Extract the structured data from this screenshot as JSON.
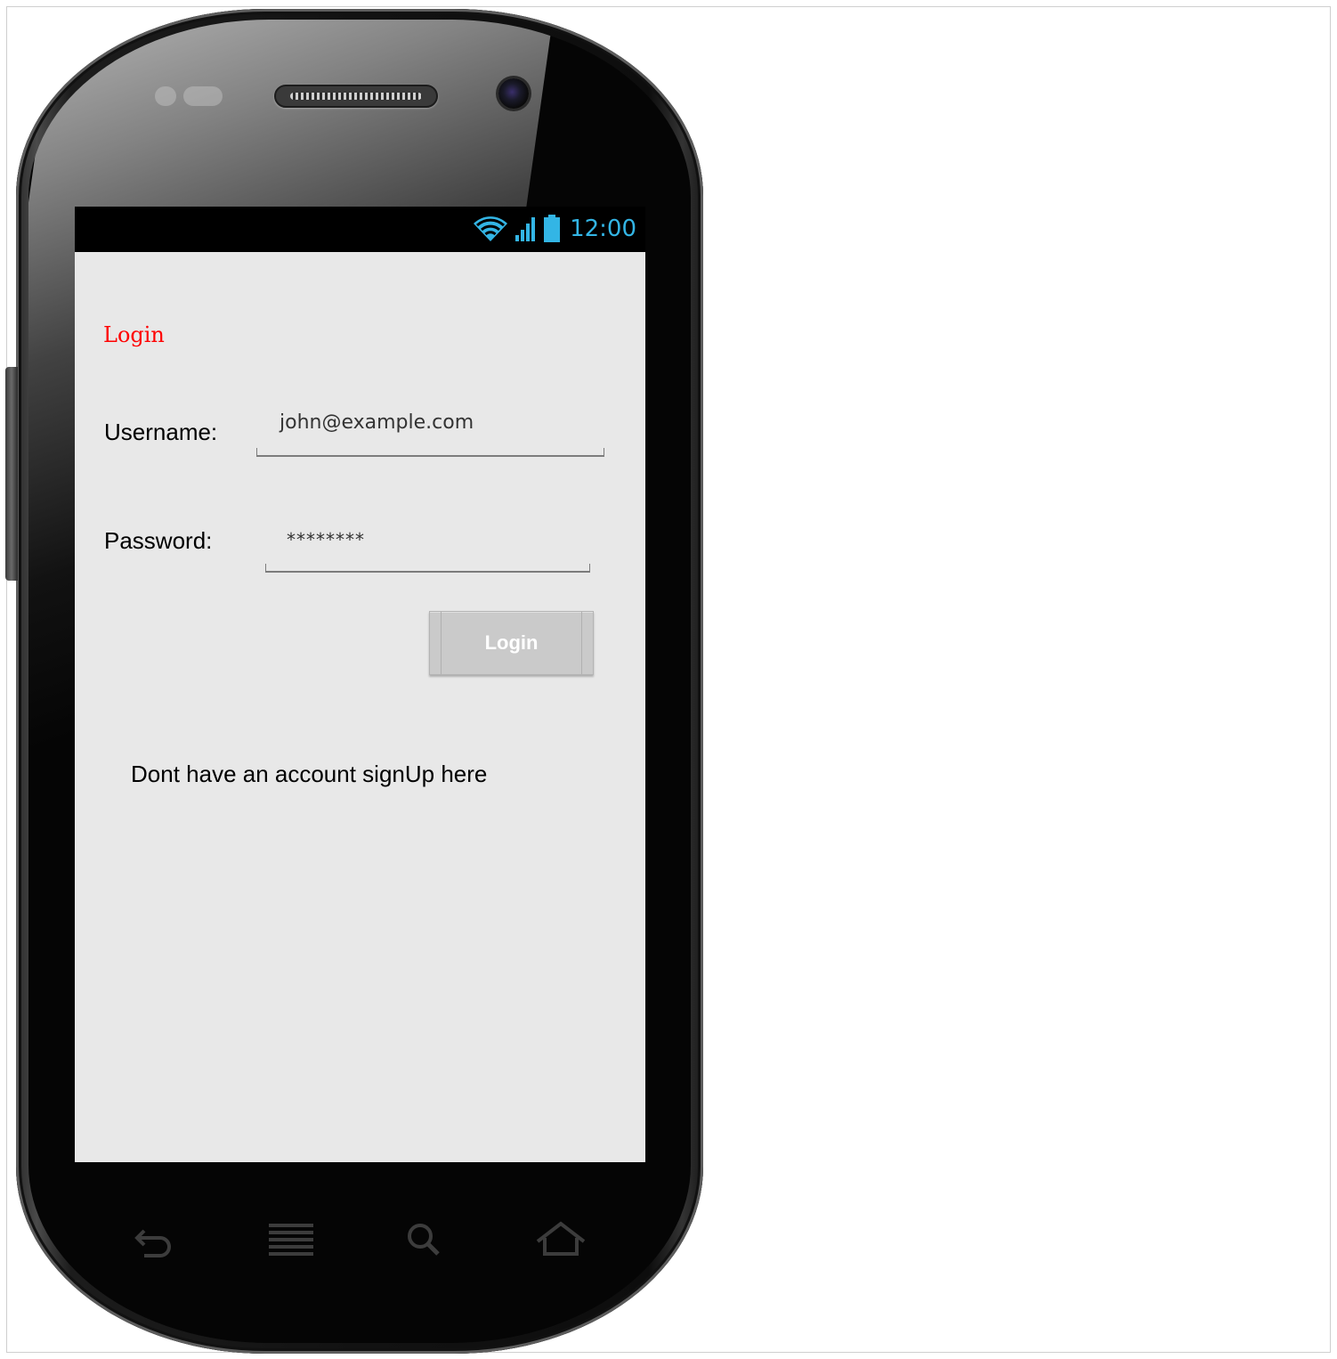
{
  "status_bar": {
    "time": "12:00",
    "icons": [
      "wifi-icon",
      "signal-icon",
      "battery-icon"
    ],
    "accent_color": "#33b5e5"
  },
  "screen": {
    "title": "Login",
    "title_color": "#ff0000",
    "background_color": "#e8e8e8"
  },
  "form": {
    "username_label": "Username:",
    "username_value": "john@example.com",
    "password_label": "Password:",
    "password_value": "********",
    "login_button": "Login"
  },
  "signup_text": "Dont have an account signUp here",
  "nav_buttons": [
    "back-icon",
    "menu-icon",
    "search-icon",
    "home-icon"
  ]
}
